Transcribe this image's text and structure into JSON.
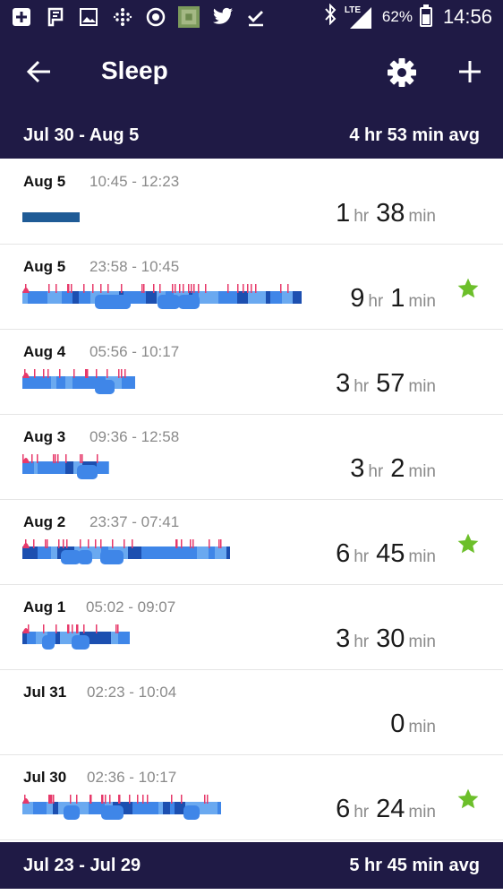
{
  "status_bar": {
    "battery": "62%",
    "network": "LTE",
    "time": "14:56",
    "icons": [
      "plus-box-icon",
      "flag-icon",
      "image-icon",
      "dots-grid-icon",
      "timer-icon",
      "thumbnail-icon",
      "twitter-icon",
      "check-icon",
      "bluetooth-icon",
      "signal-icon",
      "battery-icon"
    ]
  },
  "app_bar": {
    "title": "Sleep",
    "back_icon": "arrow-left-icon",
    "settings_icon": "gear-icon",
    "add_icon": "plus-icon"
  },
  "colors": {
    "header_bg": "#1f1a45",
    "awake": "#e7396a",
    "rem": "#6aa9f0",
    "light": "#3f86e8",
    "deep": "#1c4fb0",
    "star": "#6cbf2a",
    "unknown_bar": "#1f5b96"
  },
  "weeks": [
    {
      "range": "Jul 30 - Aug 5",
      "avg": "4 hr 53 min avg"
    },
    {
      "range": "Jul 23 - Jul 29",
      "avg": "5 hr 45 min avg"
    }
  ],
  "entries": [
    {
      "date": "Aug 5",
      "times": "10:45 - 12:23",
      "hr": "1",
      "min": "38",
      "hr_unit": "hr",
      "min_unit": "min",
      "star": false,
      "graph": "classic"
    },
    {
      "date": "Aug 5",
      "times": "23:58 - 10:45",
      "hr": "9",
      "min": "1",
      "hr_unit": "hr",
      "min_unit": "min",
      "star": true,
      "graph": "stages"
    },
    {
      "date": "Aug 4",
      "times": "05:56 - 10:17",
      "hr": "3",
      "min": "57",
      "hr_unit": "hr",
      "min_unit": "min",
      "star": false,
      "graph": "stages"
    },
    {
      "date": "Aug 3",
      "times": "09:36 - 12:58",
      "hr": "3",
      "min": "2",
      "hr_unit": "hr",
      "min_unit": "min",
      "star": false,
      "graph": "stages"
    },
    {
      "date": "Aug 2",
      "times": "23:37 - 07:41",
      "hr": "6",
      "min": "45",
      "hr_unit": "hr",
      "min_unit": "min",
      "star": true,
      "graph": "stages"
    },
    {
      "date": "Aug 1",
      "times": "05:02 - 09:07",
      "hr": "3",
      "min": "30",
      "hr_unit": "hr",
      "min_unit": "min",
      "star": false,
      "graph": "stages"
    },
    {
      "date": "Jul 31",
      "times": "02:23 - 10:04",
      "hr": "",
      "min": "0",
      "hr_unit": "",
      "min_unit": "min",
      "star": false,
      "graph": "none"
    },
    {
      "date": "Jul 30",
      "times": "02:36 - 10:17",
      "hr": "6",
      "min": "24",
      "hr_unit": "hr",
      "min_unit": "min",
      "star": true,
      "graph": "stages"
    }
  ]
}
